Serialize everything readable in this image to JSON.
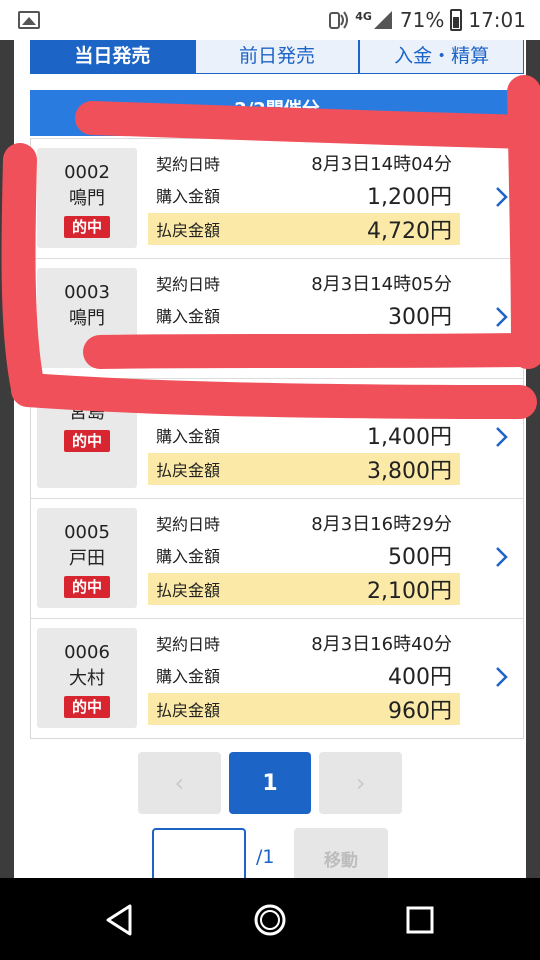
{
  "status_bar": {
    "network": "4G",
    "battery_percent": "71%",
    "time": "17:01"
  },
  "tabs": [
    {
      "label": "当日発売",
      "active": true
    },
    {
      "label": "前日発売",
      "active": false
    },
    {
      "label": "入金・精算",
      "active": false
    }
  ],
  "race_header": {
    "label": "2/2開催分"
  },
  "labels": {
    "contract_date": "契約日時",
    "purchase_amount": "購入金額",
    "payout_amount": "払戻金額"
  },
  "tickets": [
    {
      "number": "0002",
      "venue": "鳴門",
      "badge": "的中",
      "contract_time": "8月3日14時04分",
      "purchase": "1,200円",
      "payout": "4,720円"
    },
    {
      "number": "0003",
      "venue": "鳴門",
      "badge": "",
      "contract_time": "8月3日14時05分",
      "purchase": "300円",
      "payout": ""
    },
    {
      "number": "",
      "venue": "宮島",
      "badge": "的中",
      "contract_time": "8月3日16時",
      "purchase": "1,400円",
      "payout": "3,800円"
    },
    {
      "number": "0005",
      "venue": "戸田",
      "badge": "的中",
      "contract_time": "8月3日16時29分",
      "purchase": "500円",
      "payout": "2,100円"
    },
    {
      "number": "0006",
      "venue": "大村",
      "badge": "的中",
      "contract_time": "8月3日16時40分",
      "purchase": "400円",
      "payout": "960円"
    }
  ],
  "pagination": {
    "prev": "‹",
    "current": "1",
    "next": "›",
    "total": "/1",
    "move_label": "移動",
    "page_input_value": ""
  },
  "colors": {
    "primary_blue": "#1d64c7",
    "header_blue": "#2a7be0",
    "hit_red": "#d72630",
    "payout_yellow": "#fbe9a7",
    "annotation_red": "#f0505a"
  }
}
